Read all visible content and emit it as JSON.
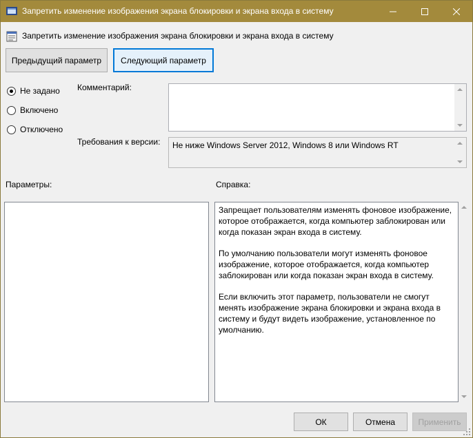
{
  "window": {
    "title": "Запретить изменение изображения экрана блокировки и экрана входа в систему",
    "controls": {
      "minimize": "—",
      "maximize": "☐",
      "close": "✕"
    }
  },
  "header": {
    "policy_title": "Запретить изменение изображения экрана блокировки и экрана входа в систему"
  },
  "nav": {
    "previous_label": "Предыдущий параметр",
    "next_label": "Следующий параметр"
  },
  "state": {
    "options": [
      "Не задано",
      "Включено",
      "Отключено"
    ],
    "selected": "Не задано"
  },
  "comment": {
    "label": "Комментарий:",
    "value": ""
  },
  "version": {
    "label": "Требования к версии:",
    "value": "Не ниже Windows Server 2012, Windows 8 или Windows RT"
  },
  "sections": {
    "parameters_label": "Параметры:",
    "help_label": "Справка:"
  },
  "help": {
    "paragraphs": [
      "Запрещает пользователям изменять фоновое изображение, которое отображается, когда компьютер заблокирован или когда показан экран входа в систему.",
      "По умолчанию пользователи могут изменять фоновое изображение, которое отображается, когда компьютер заблокирован или когда показан экран входа в систему.",
      "Если включить этот параметр, пользователи не смогут менять изображение экрана блокировки и экрана входа в систему и будут видеть изображение, установленное по умолчанию."
    ]
  },
  "footer": {
    "ok_label": "ОК",
    "cancel_label": "Отмена",
    "apply_label": "Применить"
  },
  "colors": {
    "titlebar": "#a38a3c",
    "focus_border": "#0078d7"
  }
}
